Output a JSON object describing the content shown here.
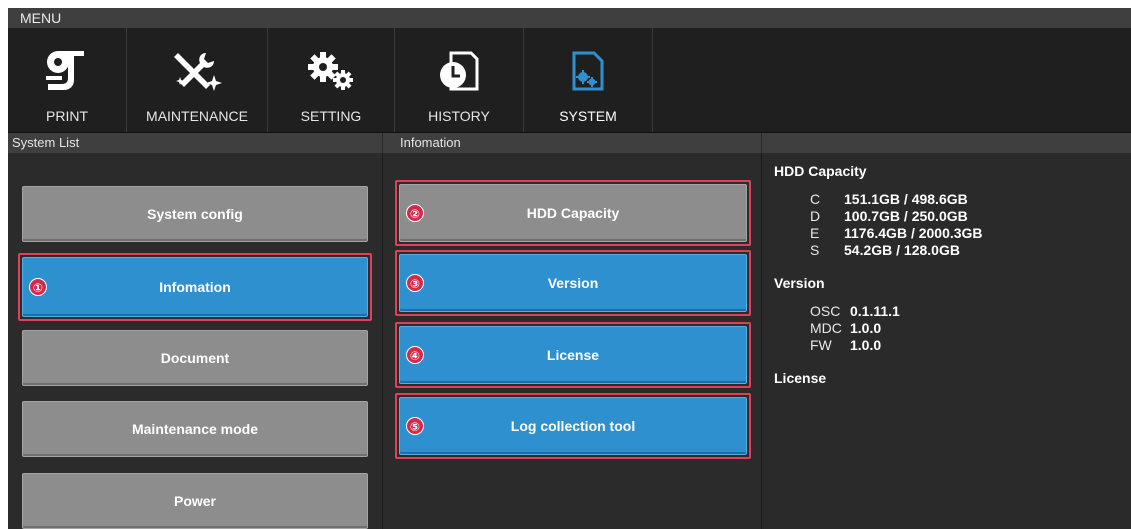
{
  "menu": {
    "title": "MENU"
  },
  "toolbar": {
    "items": [
      {
        "label": "PRINT",
        "icon": "print-icon"
      },
      {
        "label": "MAINTENANCE",
        "icon": "tools-icon"
      },
      {
        "label": "SETTING",
        "icon": "gears-icon"
      },
      {
        "label": "HISTORY",
        "icon": "history-icon"
      },
      {
        "label": "SYSTEM",
        "icon": "system-icon",
        "active": true
      }
    ]
  },
  "panels": {
    "left_title": "System List",
    "mid_title": "Infomation"
  },
  "system_list": [
    {
      "label": "System config",
      "state": "normal"
    },
    {
      "label": "Infomation",
      "state": "selected",
      "marker": "①"
    },
    {
      "label": "Document",
      "state": "normal"
    },
    {
      "label": "Maintenance mode",
      "state": "normal"
    },
    {
      "label": "Power",
      "state": "normal"
    }
  ],
  "info_buttons": [
    {
      "label": "HDD Capacity",
      "state": "normal",
      "marker": "②"
    },
    {
      "label": "Version",
      "state": "selected",
      "marker": "③"
    },
    {
      "label": "License",
      "state": "selected",
      "marker": "④"
    },
    {
      "label": "Log collection tool",
      "state": "selected",
      "marker": "⑤"
    }
  ],
  "details": {
    "hdd": {
      "title": "HDD Capacity",
      "rows": [
        {
          "key": "C",
          "value": "151.1GB / 498.6GB"
        },
        {
          "key": "D",
          "value": "100.7GB / 250.0GB"
        },
        {
          "key": "E",
          "value": "1176.4GB / 2000.3GB"
        },
        {
          "key": "S",
          "value": "54.2GB / 128.0GB"
        }
      ]
    },
    "version": {
      "title": "Version",
      "rows": [
        {
          "key": "OSC",
          "value": "0.1.11.1"
        },
        {
          "key": "MDC",
          "value": "1.0.0"
        },
        {
          "key": "FW",
          "value": "1.0.0"
        }
      ]
    },
    "license": {
      "title": "License"
    }
  },
  "colors": {
    "accent_blue": "#2f90d0",
    "button_gray": "#8d8d8d",
    "callout_red": "#e0405a"
  }
}
